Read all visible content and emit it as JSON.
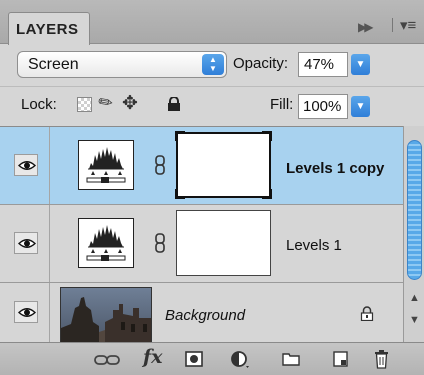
{
  "panel": {
    "tab_title": "LAYERS"
  },
  "blend": {
    "mode": "Screen",
    "opacity_label": "Opacity:",
    "opacity_value": "47%"
  },
  "lock": {
    "label": "Lock:",
    "fill_label": "Fill:",
    "fill_value": "100%"
  },
  "layers": [
    {
      "name": "Levels 1 copy",
      "selected": true,
      "visible": true
    },
    {
      "name": "Levels 1",
      "selected": false,
      "visible": true
    },
    {
      "name": "Background",
      "selected": false,
      "visible": true,
      "locked": true
    }
  ],
  "icons": {
    "expand": "double-chevron-right-icon",
    "menu": "panel-menu-icon",
    "eye": "eye-icon",
    "link": "link-layers-icon",
    "fx": "layer-style-icon",
    "mask": "add-mask-icon",
    "adjustment": "adjustment-layer-icon",
    "group": "folder-icon",
    "new": "new-layer-icon",
    "delete": "trash-icon"
  },
  "colors": {
    "selection": "#a8d2ef",
    "accent": "#3b84c9"
  },
  "toolbar": {
    "fx_label": "fx"
  }
}
